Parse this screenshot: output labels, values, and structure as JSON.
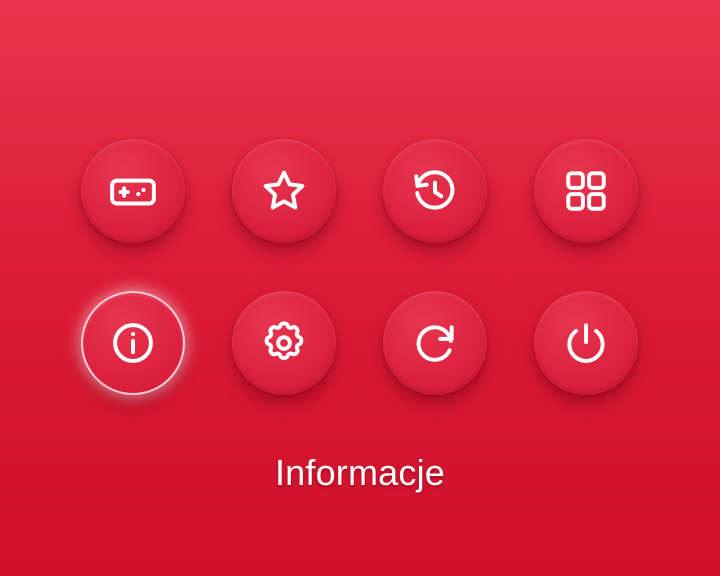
{
  "menu": {
    "items": [
      {
        "id": "games",
        "icon": "gamepad-icon"
      },
      {
        "id": "favorites",
        "icon": "star-icon"
      },
      {
        "id": "history",
        "icon": "history-icon"
      },
      {
        "id": "apps",
        "icon": "apps-grid-icon"
      },
      {
        "id": "info",
        "icon": "info-icon",
        "selected": true
      },
      {
        "id": "settings",
        "icon": "gear-icon"
      },
      {
        "id": "restart",
        "icon": "refresh-icon"
      },
      {
        "id": "power",
        "icon": "power-icon"
      }
    ],
    "selected_label": "Informacje"
  },
  "colors": {
    "background_top": "#e8344c",
    "background_bottom": "#d0102a",
    "icon": "#ffffff"
  }
}
